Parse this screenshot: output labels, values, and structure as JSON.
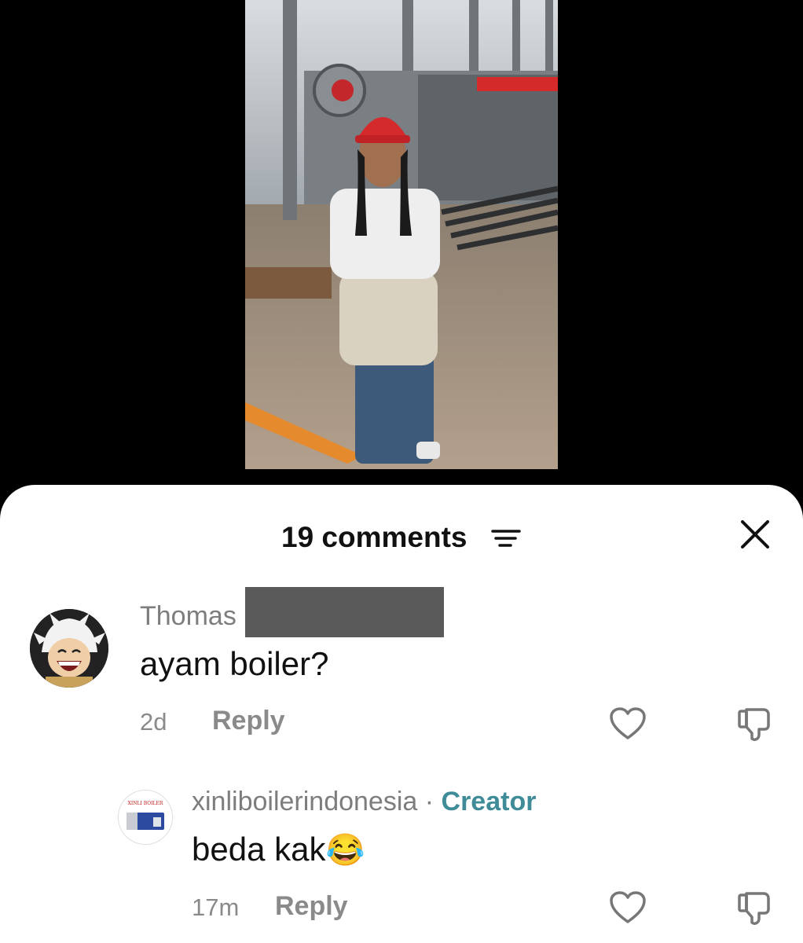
{
  "header": {
    "comment_count": "19 comments"
  },
  "comments": [
    {
      "username": "Thomas",
      "text": "ayam boiler?",
      "time": "2d",
      "reply_label": "Reply",
      "avatar_icon": "anime-character-avatar"
    }
  ],
  "replies": [
    {
      "username": "xinliboilerindonesia",
      "separator": " · ",
      "badge": "Creator",
      "text": "beda kak",
      "emoji": "😂",
      "time": "17m",
      "reply_label": "Reply",
      "avatar_label": "XINLI BOILER"
    }
  ],
  "colors": {
    "creator_badge": "#3f8c98",
    "muted": "#8a8a8a"
  }
}
